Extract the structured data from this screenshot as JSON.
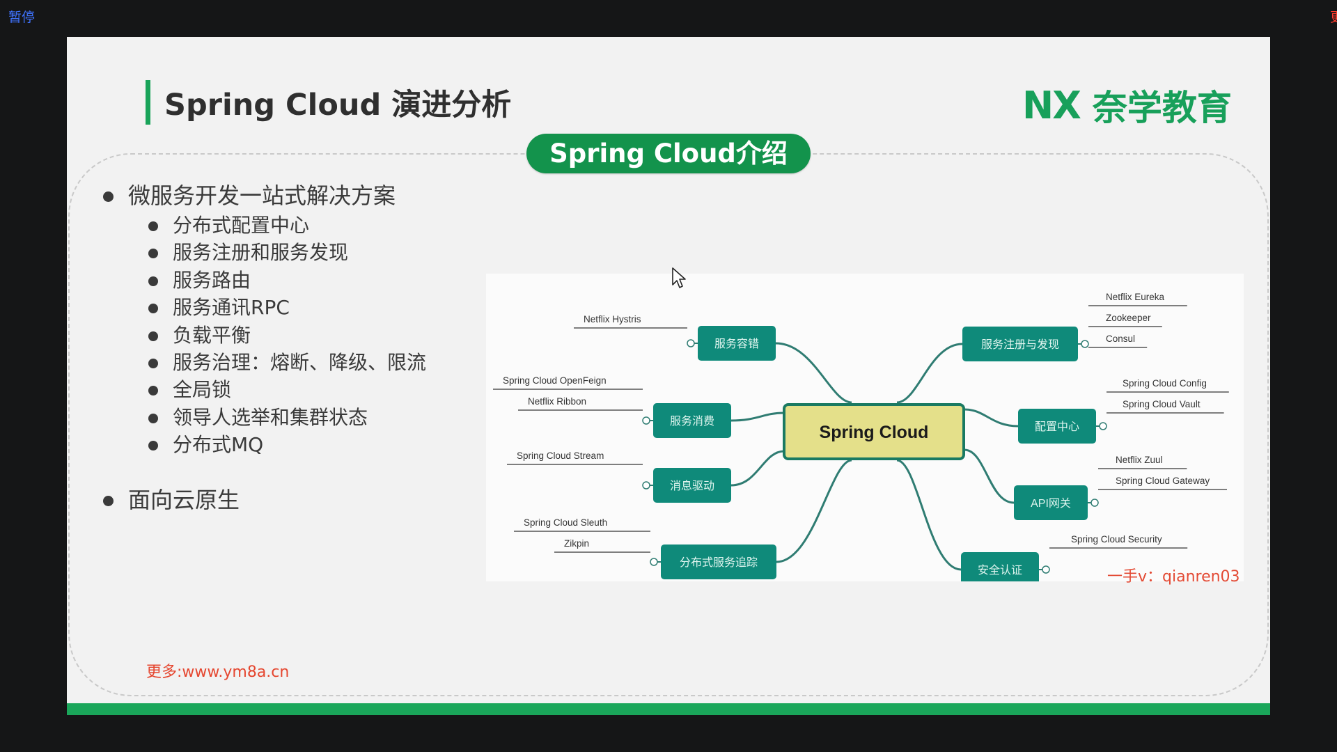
{
  "top": {
    "pause_label": "暂停",
    "edge_char": "更"
  },
  "slide": {
    "title": "Spring Cloud 演进分析",
    "logo_mark": "NX",
    "logo_text": "奈学教育",
    "pill": "Spring Cloud介绍",
    "bullets": [
      "微服务开发一站式解决方案",
      "面向云原生"
    ],
    "sub_bullets": [
      "分布式配置中心",
      "服务注册和服务发现",
      "服务路由",
      "服务通讯RPC",
      "负载平衡",
      "服务治理：熔断、降级、限流",
      "全局锁",
      "领导人选举和集群状态",
      "分布式MQ"
    ],
    "watermark_left": "更多:www.ym8a.cn",
    "watermark_right": "一手v：qianren03"
  },
  "mindmap": {
    "center": "Spring Cloud",
    "branches": [
      {
        "label": "服务容错",
        "items": [
          "Netflix Hystris"
        ]
      },
      {
        "label": "服务消费",
        "items": [
          "Spring Cloud OpenFeign",
          "Netflix Ribbon"
        ]
      },
      {
        "label": "消息驱动",
        "items": [
          "Spring Cloud Stream"
        ]
      },
      {
        "label": "分布式服务追踪",
        "items": [
          "Spring Cloud Sleuth",
          "Zikpin"
        ]
      },
      {
        "label": "服务注册与发现",
        "items": [
          "Netflix Eureka",
          "Zookeeper",
          "Consul"
        ]
      },
      {
        "label": "配置中心",
        "items": [
          "Spring Cloud Config",
          "Spring Cloud Vault"
        ]
      },
      {
        "label": "API网关",
        "items": [
          "Netflix Zuul",
          "Spring Cloud Gateway"
        ]
      },
      {
        "label": "安全认证",
        "items": [
          "Spring Cloud Security"
        ]
      }
    ]
  },
  "colors": {
    "brand_green": "#19a45a",
    "node_teal": "#0f8a7a",
    "center_fill": "#e4e08a",
    "watermark_red": "#e5462f"
  }
}
